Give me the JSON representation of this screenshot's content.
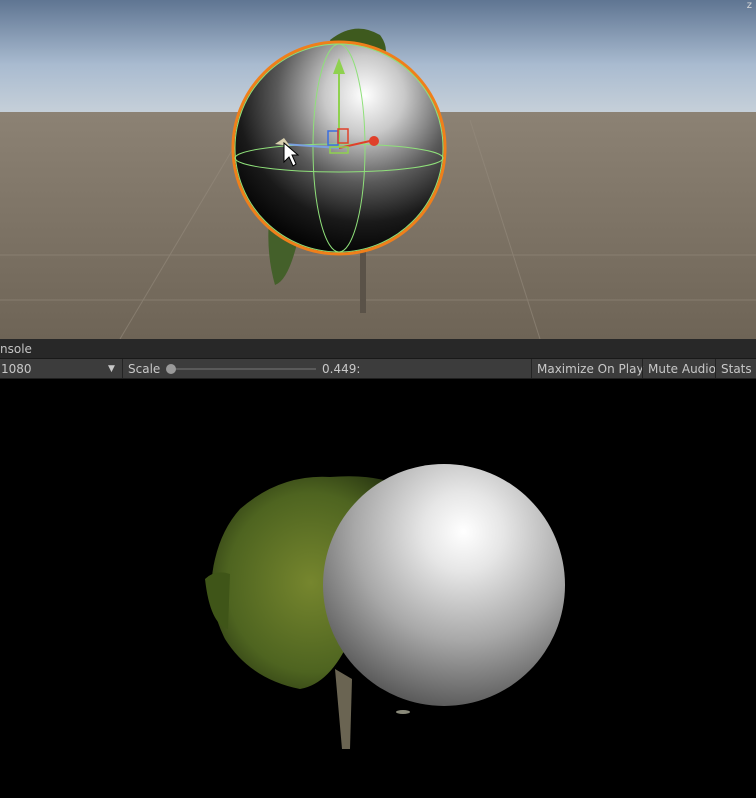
{
  "console_tab": {
    "label": "nsole"
  },
  "game_toolbar": {
    "resolution": "1080",
    "scale_label": "Scale",
    "scale_value": "0.449:",
    "scale_fraction": 0.0,
    "maximize_on_play": "Maximize On Play",
    "mute_audio": "Mute Audio",
    "stats": "Stats"
  },
  "scene": {
    "gizmo_axis_label": "z",
    "selection_outline_color": "#f07f1a",
    "ground_color": "#7a6e60",
    "sky_color": "#9fb3c9"
  },
  "icons": [
    "move-gizmo-icon",
    "dropdown-arrow-icon",
    "slider-thumb-icon",
    "mouse-cursor-icon"
  ]
}
